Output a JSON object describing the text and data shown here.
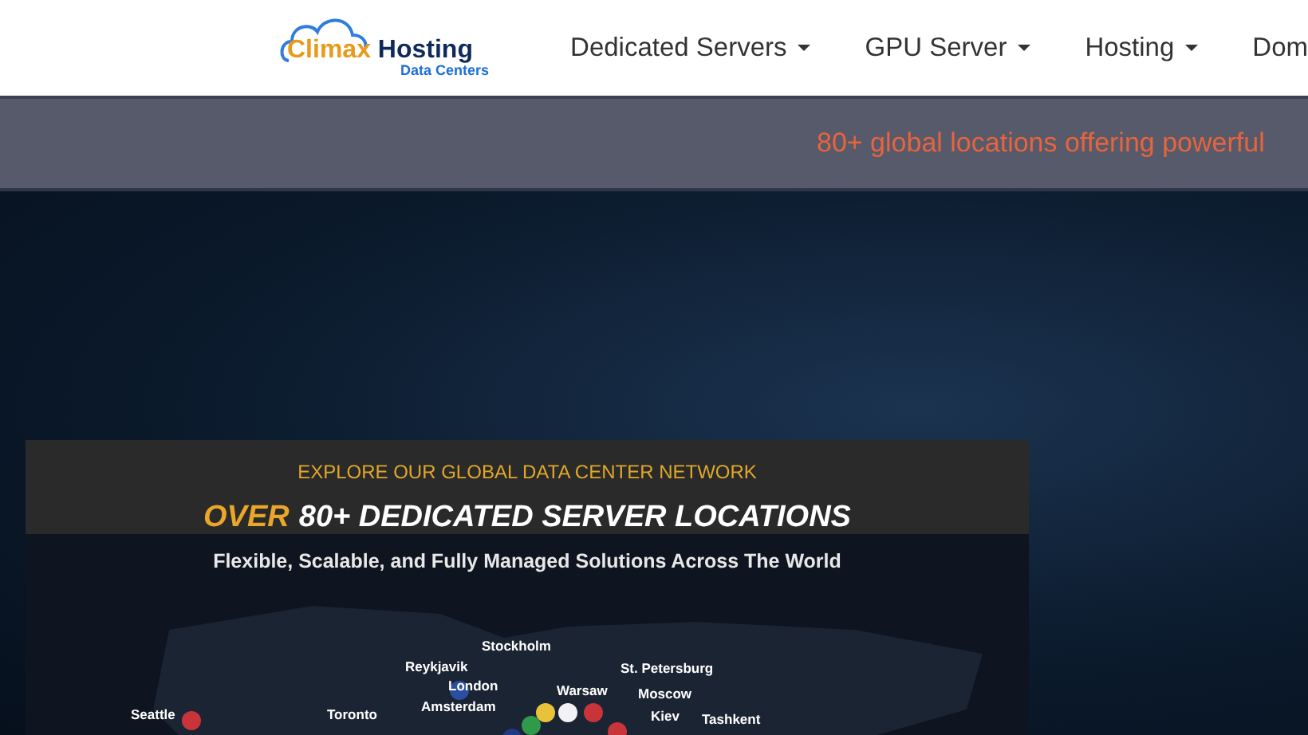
{
  "header": {
    "logo": {
      "name_part_1": "Climax",
      "name_part_2": "Hosting",
      "tagline": "Data Centers"
    },
    "nav": [
      {
        "label": "Dedicated Servers",
        "dropdown": true
      },
      {
        "label": "GPU Server",
        "dropdown": true
      },
      {
        "label": "Hosting",
        "dropdown": true
      },
      {
        "label": "Dom",
        "dropdown": false
      }
    ]
  },
  "ticker": {
    "text": "80+ global locations offering powerful"
  },
  "banner": {
    "kicker": "EXPLORE OUR GLOBAL DATA CENTER NETWORK",
    "title_lead": "OVER",
    "title_main": "80+ DEDICATED SERVER LOCATIONS",
    "subtitle": "Flexible, Scalable, and Fully Managed Solutions Across The World",
    "cities": [
      "Stockholm",
      "Reykjavik",
      "St. Petersburg",
      "London",
      "Warsaw",
      "Moscow",
      "Amsterdam",
      "Seattle",
      "Toronto",
      "Kiev",
      "Tashkent"
    ]
  }
}
